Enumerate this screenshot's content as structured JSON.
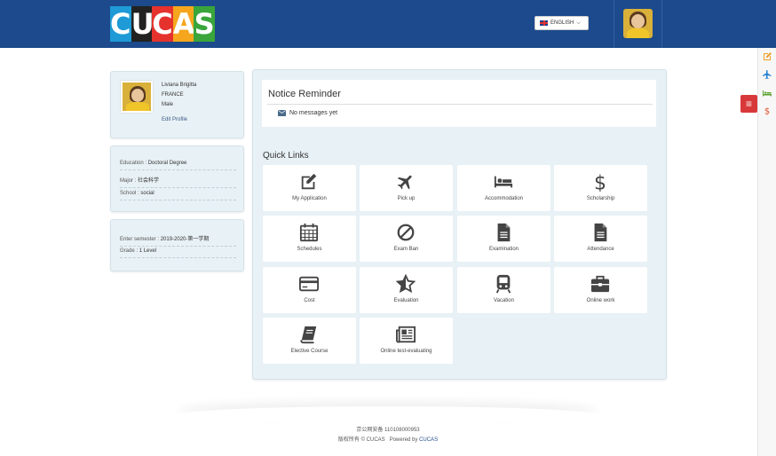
{
  "header": {
    "logo_letters": [
      "C",
      "U",
      "C",
      "A",
      "S"
    ],
    "logo_colors": [
      "#1e9ad6",
      "#222222",
      "#e5322d",
      "#f5a61d",
      "#3aa53b"
    ],
    "language_label": "ENGLISH",
    "language_caret": "⌵"
  },
  "profile": {
    "name": "Liviana Brigitta",
    "country": "FRANCE",
    "gender": "Male",
    "edit_label": "Edit Profile"
  },
  "education": {
    "education_label": "Education : ",
    "education_value": "Doctoral Degree",
    "major_label": "Major : ",
    "major_value": "社会科学",
    "school_label": "School : ",
    "school_value": "social"
  },
  "semester": {
    "enter_label": "Enter semester : ",
    "enter_value": "2019-2020-第一学期",
    "grade_label": "Grade : ",
    "grade_value": "1 Level"
  },
  "notice": {
    "title": "Notice Reminder",
    "message": "No messages yet"
  },
  "quick_links": {
    "title": "Quick Links",
    "items": [
      {
        "label": "My Application",
        "icon": "edit-icon"
      },
      {
        "label": "Pick up",
        "icon": "plane-icon"
      },
      {
        "label": "Accommodation",
        "icon": "bed-icon"
      },
      {
        "label": "Scholarship",
        "icon": "dollar-icon"
      },
      {
        "label": "Schedules",
        "icon": "calendar-icon"
      },
      {
        "label": "Exam Ban",
        "icon": "ban-icon"
      },
      {
        "label": "Examination",
        "icon": "document-icon"
      },
      {
        "label": "Attendance",
        "icon": "document-icon"
      },
      {
        "label": "Cost",
        "icon": "credit-card-icon"
      },
      {
        "label": "Evaluation",
        "icon": "star-half-icon"
      },
      {
        "label": "Vacation",
        "icon": "train-icon"
      },
      {
        "label": "Online work",
        "icon": "briefcase-icon"
      },
      {
        "label": "Elective Course",
        "icon": "book-icon"
      },
      {
        "label": "Online test-evaluating",
        "icon": "newspaper-icon"
      }
    ]
  },
  "sidebar_right": {
    "menu_icon": "≡",
    "icons": [
      "edit-icon",
      "plane-icon",
      "bed-icon",
      "dollar-icon"
    ],
    "icon_colors": [
      "#f0a030",
      "#1e7fd0",
      "#5aa02c",
      "#e0522c"
    ]
  },
  "footer": {
    "icp": "京公网安备 110108000953",
    "copyright": "版权所有 © CUCAS",
    "powered_label": "Powered by",
    "powered_brand": "CUCAS"
  }
}
